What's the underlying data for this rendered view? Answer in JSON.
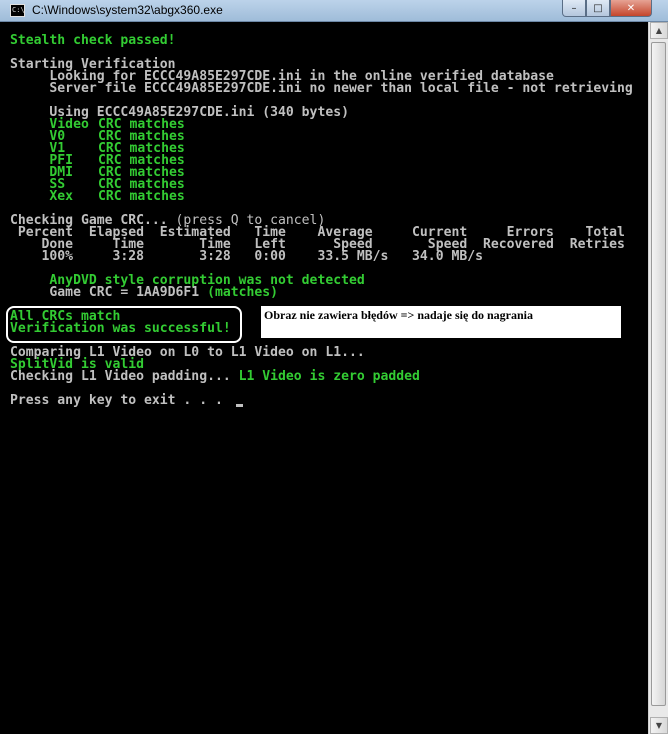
{
  "window": {
    "icon_text": "C:\\",
    "title": "C:\\Windows\\system32\\abgx360.exe",
    "buttons": {
      "minimize": "–",
      "maximize": "□",
      "close": "✕"
    }
  },
  "colors": {
    "text_white": "#c0c0c0",
    "text_green": "#33cc33",
    "background": "#000000"
  },
  "console": {
    "stealth": "Stealth check passed!",
    "starting_verification": "Starting Verification",
    "looking_for": "     Looking for ECCC49A85E297CDE.ini in the online verified database",
    "server_file": "     Server file ECCC49A85E297CDE.ini no newer than local file - not retrieving",
    "using": "     Using ECCC49A85E297CDE.ini (340 bytes)",
    "crc_rows": [
      {
        "name": "     Video",
        "status": "CRC matches"
      },
      {
        "name": "     V0",
        "status": "CRC matches"
      },
      {
        "name": "     V1",
        "status": "CRC matches"
      },
      {
        "name": "     PFI",
        "status": "CRC matches"
      },
      {
        "name": "     DMI",
        "status": "CRC matches"
      },
      {
        "name": "     SS",
        "status": "CRC matches"
      },
      {
        "name": "     Xex",
        "status": "CRC matches"
      }
    ],
    "checking_game_crc": "Checking Game CRC... ",
    "press_q": "(press Q to cancel)",
    "progress_header_1": " Percent  Elapsed  Estimated   Time    Average     Current     Errors    Total",
    "progress_header_2": "    Done     Time       Time   Left      Speed       Speed  Recovered  Retries",
    "progress_values": "    100%     3:28       3:28   0:00    33.5 MB/s   34.0 MB/s",
    "anydvd": "     AnyDVD style corruption was not detected",
    "game_crc_prefix": "     Game CRC = 1AA9D6F1 ",
    "game_crc_suffix": "(matches)",
    "all_crcs_match": "All CRCs match",
    "verification_success": "Verification was successful!",
    "comparing": "Comparing L1 Video on L0 to L1 Video on L1...",
    "splitvid": "SplitVid is valid",
    "checking_padding": "Checking L1 Video padding... ",
    "padding_result": "L1 Video is zero padded",
    "press_any_key": "Press any key to exit . . . "
  },
  "annotation": {
    "note": "Obraz nie zawiera błędów => nadaje się do nagrania"
  },
  "scrollbar": {
    "up": "▲",
    "down": "▼"
  }
}
